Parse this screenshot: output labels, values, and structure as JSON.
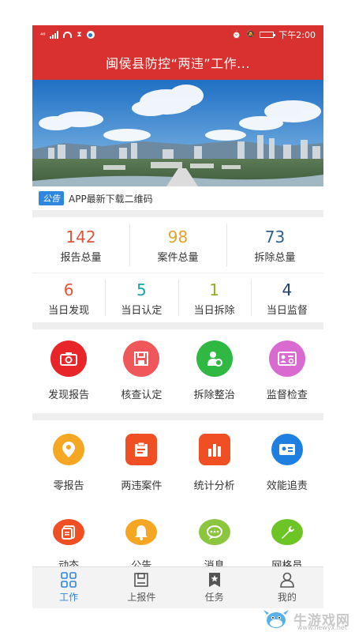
{
  "status_bar": {
    "left_text": "⁴⁶",
    "time": "下午2:00"
  },
  "header": {
    "title": "闽侯县防控“两违”工作..."
  },
  "notice": {
    "tag": "公告",
    "text": "APP最新下载二维码"
  },
  "stats_totals": [
    {
      "value": "142",
      "label": "报告总量",
      "color": "#e0543c"
    },
    {
      "value": "98",
      "label": "案件总量",
      "color": "#e0a42a"
    },
    {
      "value": "73",
      "label": "拆除总量",
      "color": "#2f5f8f"
    }
  ],
  "stats_daily": [
    {
      "value": "6",
      "label": "当日发现",
      "color": "#e0543c"
    },
    {
      "value": "5",
      "label": "当日认定",
      "color": "#18a6a6"
    },
    {
      "value": "1",
      "label": "当日拆除",
      "color": "#8fb01c"
    },
    {
      "value": "4",
      "label": "当日监督",
      "color": "#1f3f6f"
    }
  ],
  "main_functions": [
    {
      "label": "发现报告",
      "icon": "camera-icon",
      "color": "#e8262a"
    },
    {
      "label": "核查认定",
      "icon": "save-icon",
      "color": "#f0575a"
    },
    {
      "label": "拆除整治",
      "icon": "user-gear-icon",
      "color": "#2fb842"
    },
    {
      "label": "监督检查",
      "icon": "id-card-search-icon",
      "color": "#d86ad0"
    }
  ],
  "tools": [
    {
      "label": "零报告",
      "icon": "location-user-icon",
      "color": "#f5a623"
    },
    {
      "label": "两违案件",
      "icon": "clipboard-icon",
      "color": "#f04e23"
    },
    {
      "label": "统计分析",
      "icon": "bar-chart-icon",
      "color": "#f04e23"
    },
    {
      "label": "效能追责",
      "icon": "id-card-icon",
      "color": "#1e7fe0"
    }
  ],
  "more_tools": [
    {
      "label": "动态",
      "icon": "news-icon",
      "color": "#f04e23"
    },
    {
      "label": "公告",
      "icon": "bell-icon",
      "color": "#f5a623"
    },
    {
      "label": "消息",
      "icon": "chat-icon",
      "color": "#8cc63f"
    },
    {
      "label": "网格员",
      "icon": "wrench-icon",
      "color": "#6cc524"
    }
  ],
  "tabbar": [
    {
      "label": "工作",
      "icon": "grid-icon",
      "active": true
    },
    {
      "label": "上报件",
      "icon": "inbox-icon",
      "active": false
    },
    {
      "label": "任务",
      "icon": "star-flag-icon",
      "active": false
    },
    {
      "label": "我的",
      "icon": "person-icon",
      "active": false
    }
  ],
  "watermark": {
    "text": "牛游戏网",
    "url": "www.newyx.net"
  }
}
